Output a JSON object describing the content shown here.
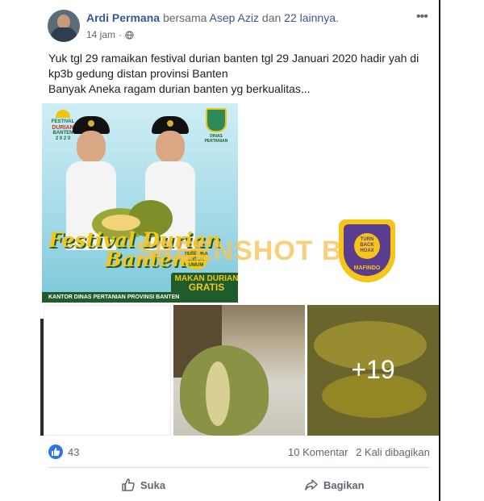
{
  "post": {
    "author": "Ardi Permana",
    "with_word": "bersama",
    "tagged": "Asep Aziz",
    "and_word": "dan",
    "others": "22 lainnya",
    "time": "14 jam",
    "privacy_icon": "globe-icon",
    "more_icon": "ellipsis-icon",
    "text_lines": [
      "Yuk tgl 29 ramaikan festival durian banten tgl 29 Januari 2020 hadir yah di",
      "kp3b gedung distan provinsi Banten",
      "Banyak Aneka ragam durian banten yg berkualitas..."
    ]
  },
  "poster": {
    "logo_top": "FESTIVAL",
    "logo_mid": "DURIAN",
    "logo_bottom": "BANTEN",
    "logo_year": "2 0 2 0",
    "dinas_label": "DINAS PERTANIAN",
    "title_line1": "Festival Durian",
    "title_line2": "Banten",
    "badge": "TERBUKA UNTUK UMUM",
    "makan_line1": "MAKAN DURIAN",
    "makan_line2": "GRATIS",
    "kantor": "KANTOR DINAS PERTANIAN PROVINSI BANTEN"
  },
  "watermark": {
    "text": "SREENSHOT BY",
    "logo_top": "MASYARAKAT ANTI FITNAH INDONESIA",
    "logo_center": "TURN BACK HOAX",
    "logo_bottom": "MAFINDO"
  },
  "gallery": {
    "more_count": "+19"
  },
  "stats": {
    "like_icon": "thumbs-up-icon",
    "like_count": "43",
    "comments": "10 Komentar",
    "shares": "2 Kali dibagikan"
  },
  "actions": {
    "like_label": "Suka",
    "share_label": "Bagikan"
  },
  "colors": {
    "link": "#385898",
    "muted": "#606770",
    "like_blue": "#2e74e8"
  }
}
